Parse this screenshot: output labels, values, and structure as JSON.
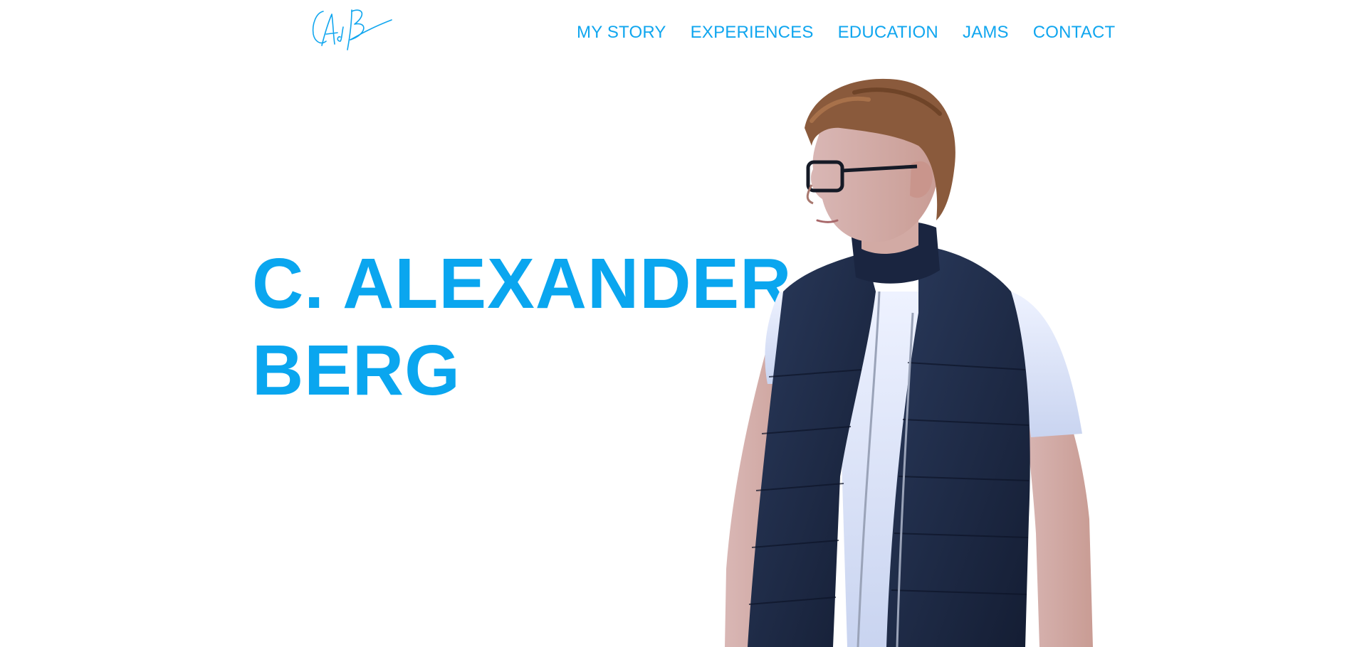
{
  "site": {
    "logo_alt": "C.A. Berg signature",
    "name_line_1": "C. ALEXANDER",
    "name_line_2": "BERG"
  },
  "nav": {
    "items": [
      {
        "label": "MY STORY"
      },
      {
        "label": "EXPERIENCES"
      },
      {
        "label": "EDUCATION"
      },
      {
        "label": "JAMS"
      },
      {
        "label": "CONTACT"
      }
    ]
  },
  "colors": {
    "accent": "#10a6ef",
    "background": "#ffffff"
  },
  "icons": {
    "logo": "signature-logo-icon"
  }
}
